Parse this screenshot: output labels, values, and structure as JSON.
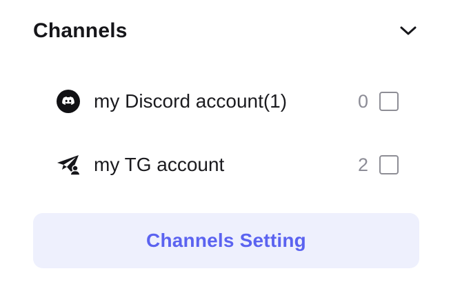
{
  "header": {
    "title": "Channels",
    "toggle_icon": "chevron-down-icon"
  },
  "channels": [
    {
      "icon": "discord-icon",
      "label": "my Discord account(1)",
      "count": "0",
      "checked": false
    },
    {
      "icon": "telegram-icon",
      "label": "my TG account",
      "count": "2",
      "checked": false
    }
  ],
  "settings_button": {
    "label": "Channels Setting"
  },
  "colors": {
    "accent": "#5b63f0",
    "button_bg": "#eef0fd",
    "count_text": "#8c8c96",
    "checkbox_border": "#8d8d95"
  }
}
